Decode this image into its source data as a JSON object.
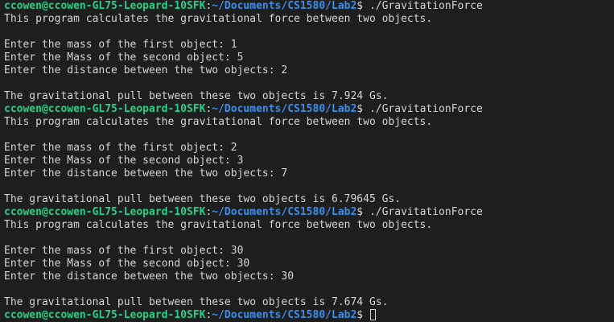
{
  "prompt": {
    "user_host": "ccowen@ccowen-GL75-Leopard-10SFK",
    "colon": ":",
    "path": "~/Documents/CS1580/Lab2",
    "dollar": "$"
  },
  "colors": {
    "background": "#1e1e1e",
    "text": "#d4d4d4",
    "prompt_user": "#23d18b",
    "prompt_path": "#3b8eea"
  },
  "runs": [
    {
      "command": "./GravitationForce",
      "intro": "This program calculates the gravitational force between two objects.",
      "mass1_prompt": "Enter the mass of the first object: ",
      "mass1_value": "1",
      "mass2_prompt": "Enter the Mass of the second object: ",
      "mass2_value": "5",
      "distance_prompt": "Enter the distance between the two objects: ",
      "distance_value": "2",
      "result": "The gravitational pull between these two objects is 7.924 Gs."
    },
    {
      "command": "./GravitationForce",
      "intro": "This program calculates the gravitational force between two objects.",
      "mass1_prompt": "Enter the mass of the first object: ",
      "mass1_value": "2",
      "mass2_prompt": "Enter the Mass of the second object: ",
      "mass2_value": "3",
      "distance_prompt": "Enter the distance between the two objects: ",
      "distance_value": "7",
      "result": "The gravitational pull between these two objects is 6.79645 Gs."
    },
    {
      "command": "./GravitationForce",
      "intro": "This program calculates the gravitational force between two objects.",
      "mass1_prompt": "Enter the mass of the first object: ",
      "mass1_value": "30",
      "mass2_prompt": "Enter the Mass of the second object: ",
      "mass2_value": "30",
      "distance_prompt": "Enter the distance between the two objects: ",
      "distance_value": "30",
      "result": "The gravitational pull between these two objects is 7.674 Gs."
    }
  ]
}
